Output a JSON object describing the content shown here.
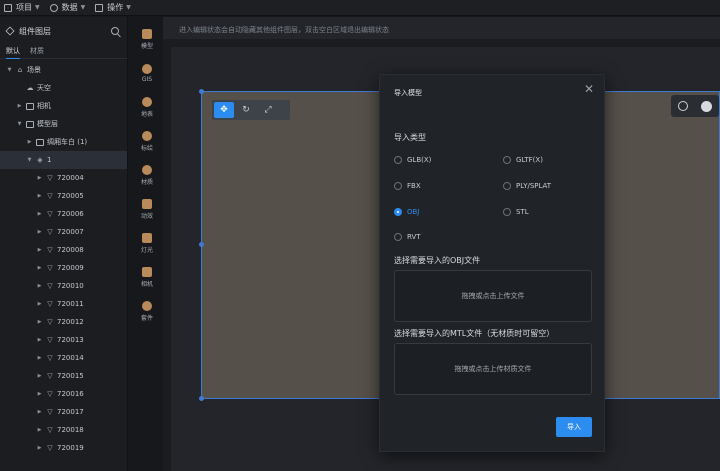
{
  "menubar": {
    "items": [
      {
        "label": "项目",
        "icon": "document-icon"
      },
      {
        "label": "数据",
        "icon": "database-icon"
      },
      {
        "label": "操作",
        "icon": "grid-icon"
      }
    ]
  },
  "left_panel": {
    "title": "组件图层",
    "tabs": [
      "默认",
      "材质"
    ],
    "tree": [
      {
        "label": "场景",
        "expanded": true
      },
      {
        "label": "天空"
      },
      {
        "label": "相机"
      },
      {
        "label": "模型层",
        "expanded": true
      },
      {
        "label": "绸厢车白 (1)"
      },
      {
        "label": "1",
        "selected": true
      },
      {
        "label": "720004"
      },
      {
        "label": "720005"
      },
      {
        "label": "720006"
      },
      {
        "label": "720007"
      },
      {
        "label": "720008"
      },
      {
        "label": "720009"
      },
      {
        "label": "720010"
      },
      {
        "label": "720011"
      },
      {
        "label": "720012"
      },
      {
        "label": "720013"
      },
      {
        "label": "720014"
      },
      {
        "label": "720015"
      },
      {
        "label": "720016"
      },
      {
        "label": "720017"
      },
      {
        "label": "720018"
      },
      {
        "label": "720019"
      }
    ]
  },
  "toolstrip": {
    "items": [
      {
        "label": "模型",
        "icon": "model-icon"
      },
      {
        "label": "GIS",
        "icon": "globe-icon"
      },
      {
        "label": "地表",
        "icon": "terrain-icon"
      },
      {
        "label": "标绘",
        "icon": "marker-icon"
      },
      {
        "label": "材质",
        "icon": "material-icon"
      },
      {
        "label": "动效",
        "icon": "effect-icon"
      },
      {
        "label": "灯光",
        "icon": "light-icon"
      },
      {
        "label": "相机",
        "icon": "camera-icon"
      },
      {
        "label": "套件",
        "icon": "kit-icon"
      }
    ]
  },
  "canvas": {
    "notice": "进入编辑状态会自动隐藏其他组件图层，双击空白区域退出编辑状态"
  },
  "modal": {
    "title": "导入模型",
    "type_label": "导入类型",
    "options": [
      "GLB(X)",
      "GLTF(X)",
      "FBX",
      "PLY/SPLAT",
      "OBJ",
      "STL",
      "RVT"
    ],
    "selected": "OBJ",
    "obj_label": "选择需要导入的OBJ文件",
    "obj_upload": "拖拽或点击上传文件",
    "mtl_label": "选择需要导入的MTL文件（无材质时可留空）",
    "mtl_upload": "拖拽或点击上传材质文件",
    "import_button": "导入"
  },
  "colors": {
    "accent": "#2d8cf0",
    "background": "#16181c",
    "panel": "#1b1d21",
    "scene": "#56504a"
  }
}
